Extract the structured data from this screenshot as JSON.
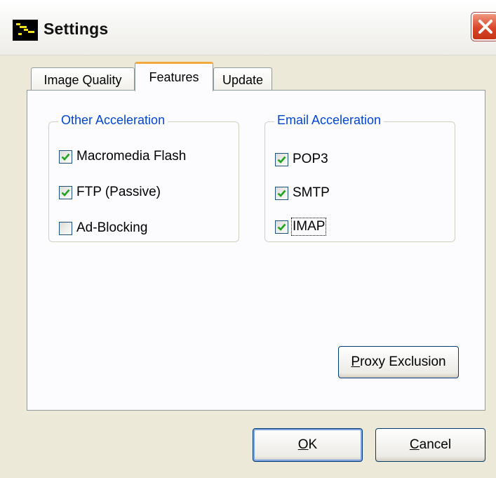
{
  "window": {
    "title": "Settings"
  },
  "tabs": [
    {
      "label": "Image Quality",
      "active": false
    },
    {
      "label": "Features",
      "active": true
    },
    {
      "label": "Update",
      "active": false
    }
  ],
  "other_acceleration": {
    "title": "Other Acceleration",
    "items": [
      {
        "label": "Macromedia Flash",
        "checked": true
      },
      {
        "label": "FTP (Passive)",
        "checked": true
      },
      {
        "label": "Ad-Blocking",
        "checked": false
      }
    ]
  },
  "email_acceleration": {
    "title": "Email Acceleration",
    "items": [
      {
        "label": "POP3",
        "checked": true
      },
      {
        "label": "SMTP",
        "checked": true
      },
      {
        "label": "IMAP",
        "checked": true
      }
    ]
  },
  "buttons": {
    "proxy_exclusion": {
      "mnemonic": "P",
      "rest": "roxy Exclusion"
    },
    "ok": {
      "mnemonic": "O",
      "rest": "K"
    },
    "cancel": {
      "mnemonic": "C",
      "rest": "ancel"
    }
  },
  "colors": {
    "accent_blue": "#0046d5",
    "check_green": "#21a121",
    "active_tab_highlight": "#f2a93c",
    "close_red": "#d8452a"
  },
  "icons": {
    "app": "app-logo-icon",
    "close": "close-icon",
    "check": "checkmark-icon"
  }
}
